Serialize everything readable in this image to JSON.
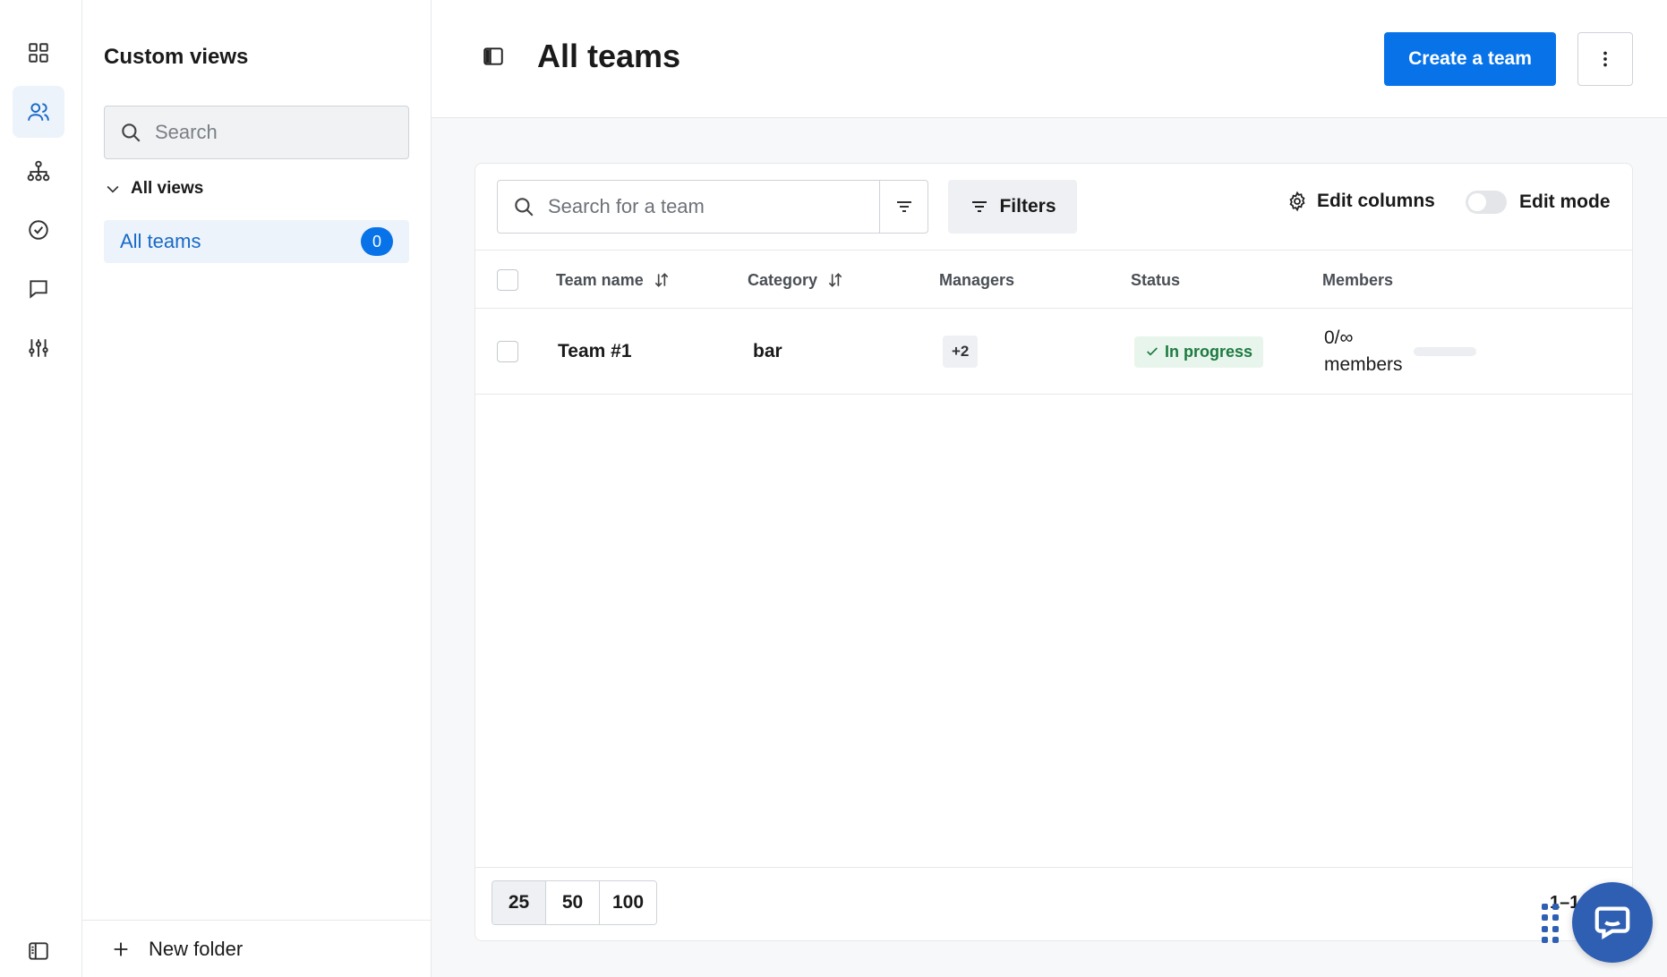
{
  "rail": {
    "icons": [
      "dashboard-icon",
      "users-icon",
      "org-chart-icon",
      "check-circle-icon",
      "chat-icon",
      "sliders-icon",
      "collapse-sidebar-icon"
    ]
  },
  "views": {
    "title": "Custom views",
    "search_placeholder": "Search",
    "all_views_label": "All views",
    "items": [
      {
        "label": "All teams",
        "count": "0"
      }
    ],
    "new_folder_label": "New folder"
  },
  "header": {
    "title": "All teams",
    "create_label": "Create a team"
  },
  "toolbar": {
    "search_placeholder": "Search for a team",
    "filters_label": "Filters",
    "edit_columns_label": "Edit columns",
    "edit_mode_label": "Edit mode"
  },
  "table": {
    "columns": [
      "Team name",
      "Category",
      "Managers",
      "Status",
      "Members"
    ],
    "rows": [
      {
        "team_name": "Team #1",
        "category": "bar",
        "managers": "+2",
        "status": "In progress",
        "members_count": "0/∞",
        "members_unit": "members"
      }
    ]
  },
  "pagination": {
    "sizes": [
      "25",
      "50",
      "100"
    ],
    "range": "1–1"
  },
  "colors": {
    "accent": "#0873e8",
    "status_green": "#1d7a40",
    "chat_blue": "#2f5fb3"
  }
}
